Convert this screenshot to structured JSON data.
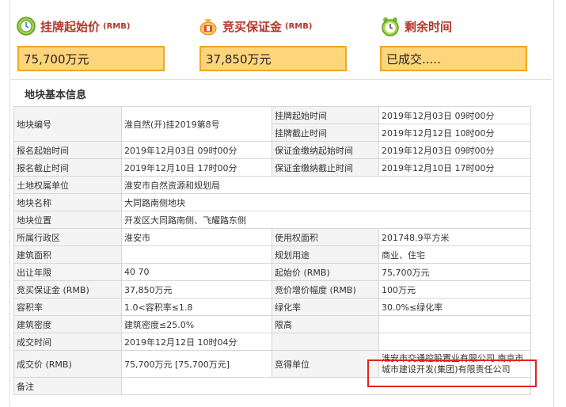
{
  "header": {
    "start_price": {
      "label": "挂牌起始价",
      "unit": "(RMB)",
      "value": "75,700万元"
    },
    "deposit": {
      "label": "竞买保证金",
      "unit": "(RMB)",
      "value": "37,850万元"
    },
    "remaining": {
      "label": "剩余时间",
      "value": "已成交....."
    }
  },
  "section_title": "地块基本信息",
  "rows": {
    "parcel_no": {
      "label": "地块编号",
      "value": "淮自然(开)挂2019第8号"
    },
    "listing_start": {
      "label": "挂牌起始时间",
      "value": "2019年12月03日 09时00分"
    },
    "listing_end": {
      "label": "挂牌截止时间",
      "value": "2019年12月12日 10时00分"
    },
    "signup_start": {
      "label": "报名起始时间",
      "value": "2019年12月03日 09时00分"
    },
    "deposit_start": {
      "label": "保证金缴纳起始时间",
      "value": "2019年12月03日 09时00分"
    },
    "signup_end": {
      "label": "报名截止时间",
      "value": "2019年12月10日 17时00分"
    },
    "deposit_end": {
      "label": "保证金缴纳截止时间",
      "value": "2019年12月10日 17时00分"
    },
    "owner": {
      "label": "土地权属单位",
      "value": "淮安市自然资源和规划局"
    },
    "name": {
      "label": "地块名称",
      "value": "大同路南侧地块"
    },
    "location": {
      "label": "地块位置",
      "value": "开发区大同路南侧、飞耀路东侧"
    },
    "district": {
      "label": "所属行政区",
      "value": "淮安市"
    },
    "area": {
      "label": "使用权面积",
      "value": "201748.9平方米"
    },
    "building_area": {
      "label": "建筑面积",
      "value": ""
    },
    "usage": {
      "label": "规划用途",
      "value": "商业、住宅"
    },
    "term": {
      "label": "出让年限",
      "value": "40 70"
    },
    "base_price": {
      "label": "起始价 (RMB)",
      "value": "75,700万元"
    },
    "bid_deposit": {
      "label": "竞买保证金 (RMB)",
      "value": "37,850万元"
    },
    "increment": {
      "label": "竞价增价幅度 (RMB)",
      "value": "100万元"
    },
    "far": {
      "label": "容积率",
      "value": "1.0<容积率≤1.8"
    },
    "green": {
      "label": "绿化率",
      "value": "30.0%≤绿化率"
    },
    "density": {
      "label": "建筑密度",
      "value": "建筑密度≤25.0%"
    },
    "height": {
      "label": "限高",
      "value": ""
    },
    "deal_time": {
      "label": "成交时间",
      "value": "2019年12月12日 10时04分"
    },
    "deal_price": {
      "label": "成交价 (RMB)",
      "value": "75,700万元 [75,700万元]"
    },
    "winner": {
      "label": "竞得单位",
      "value": "淮安市交通控股置业有限公司 南京市城市建设开发(集团)有限责任公司"
    },
    "remarks": {
      "label": "备注",
      "value": ""
    }
  },
  "colors": {
    "accent_red": "#b3362a",
    "box_fill": "#ffd57c",
    "box_border": "#f0a626",
    "highlight": "#e3231f"
  }
}
